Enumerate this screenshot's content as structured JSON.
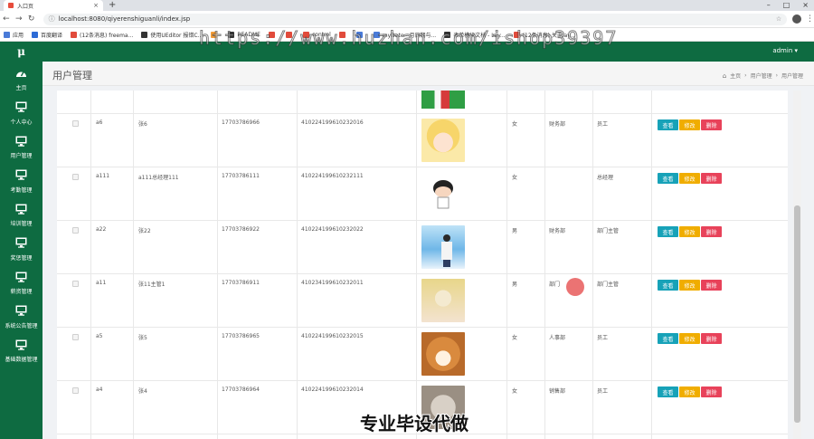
{
  "browser": {
    "tab_title": "入口页",
    "url": "localhost:8080/qiyerenshiguanli/index.jsp",
    "bookmarks": [
      {
        "label": "应用",
        "color": "#4a7bd8"
      },
      {
        "label": "百度翻译",
        "color": "#2d6bd6"
      },
      {
        "label": "(12条消息) freema...",
        "color": "#e14b3b"
      },
      {
        "label": "使用UEditor 报错C...",
        "color": "#333333"
      },
      {
        "label": "",
        "color": "#f29c38"
      },
      {
        "label": "README",
        "color": "#333333"
      },
      {
        "label": "",
        "color": "#e14b3b"
      },
      {
        "label": "",
        "color": "#e14b3b"
      },
      {
        "label": "control",
        "color": "#e14b3b"
      },
      {
        "label": "",
        "color": "#e14b3b"
      },
      {
        "label": "",
        "color": "#4a7bd8"
      },
      {
        "label": "myDate - 月日期与...",
        "color": "#4a7bd8"
      },
      {
        "label": "表单模块文档 - Lay...",
        "color": "#333333"
      },
      {
        "label": "(12条消息) 关于lay...",
        "color": "#e14b3b"
      }
    ]
  },
  "header": {
    "logo": "μ",
    "admin": "admin ▾"
  },
  "sidebar": {
    "items": [
      {
        "label": "主页",
        "icon": "dashboard-icon"
      },
      {
        "label": "个人中心",
        "icon": "monitor-icon"
      },
      {
        "label": "用户管理",
        "icon": "monitor-icon"
      },
      {
        "label": "考勤管理",
        "icon": "monitor-icon"
      },
      {
        "label": "培训管理",
        "icon": "monitor-icon"
      },
      {
        "label": "奖惩管理",
        "icon": "monitor-icon"
      },
      {
        "label": "薪资管理",
        "icon": "monitor-icon"
      },
      {
        "label": "系统公告管理",
        "icon": "monitor-icon"
      },
      {
        "label": "基础数据管理",
        "icon": "monitor-icon"
      }
    ]
  },
  "page": {
    "title": "用户管理",
    "breadcrumb": [
      "主页",
      "用户管理",
      "用户管理"
    ]
  },
  "table": {
    "actions": {
      "view": "查看",
      "edit": "修改",
      "delete": "删除"
    },
    "rows": [
      {
        "account": "a6",
        "name": "张6",
        "phone": "17703786966",
        "idcard": "410224199610232016",
        "photo": "anime-girl",
        "gender": "女",
        "dept": "财务部",
        "position": "员工"
      },
      {
        "account": "a111",
        "name": "a111总经理111",
        "phone": "17703786111",
        "idcard": "410224199610232111",
        "photo": "cartoon-boy",
        "gender": "女",
        "dept": "",
        "position": "总经理"
      },
      {
        "account": "a22",
        "name": "张22",
        "phone": "17703786922",
        "idcard": "410224199610232022",
        "photo": "sky-person",
        "gender": "男",
        "dept": "财务部",
        "position": "部门主管"
      },
      {
        "account": "a11",
        "name": "张11主管1",
        "phone": "17703786911",
        "idcard": "410234199610232011",
        "photo": "fairy-girl",
        "gender": "男",
        "dept": "部门",
        "position": "部门主管"
      },
      {
        "account": "a5",
        "name": "张5",
        "phone": "17703786965",
        "idcard": "410224199610232015",
        "photo": "shiba-dog",
        "gender": "女",
        "dept": "人事部",
        "position": "员工"
      },
      {
        "account": "a4",
        "name": "张4",
        "phone": "17703786964",
        "idcard": "410224199610232014",
        "photo": "cat",
        "gender": "女",
        "dept": "销售部",
        "position": "员工"
      }
    ]
  },
  "overlay": {
    "watermark": "https://www.huzhan.com/ishop39397",
    "caption": "专业毕设代做"
  },
  "colors": {
    "brand_green": "#0e6b41",
    "view": "#17a2b8",
    "edit": "#f0ad00",
    "delete": "#e8425a"
  }
}
